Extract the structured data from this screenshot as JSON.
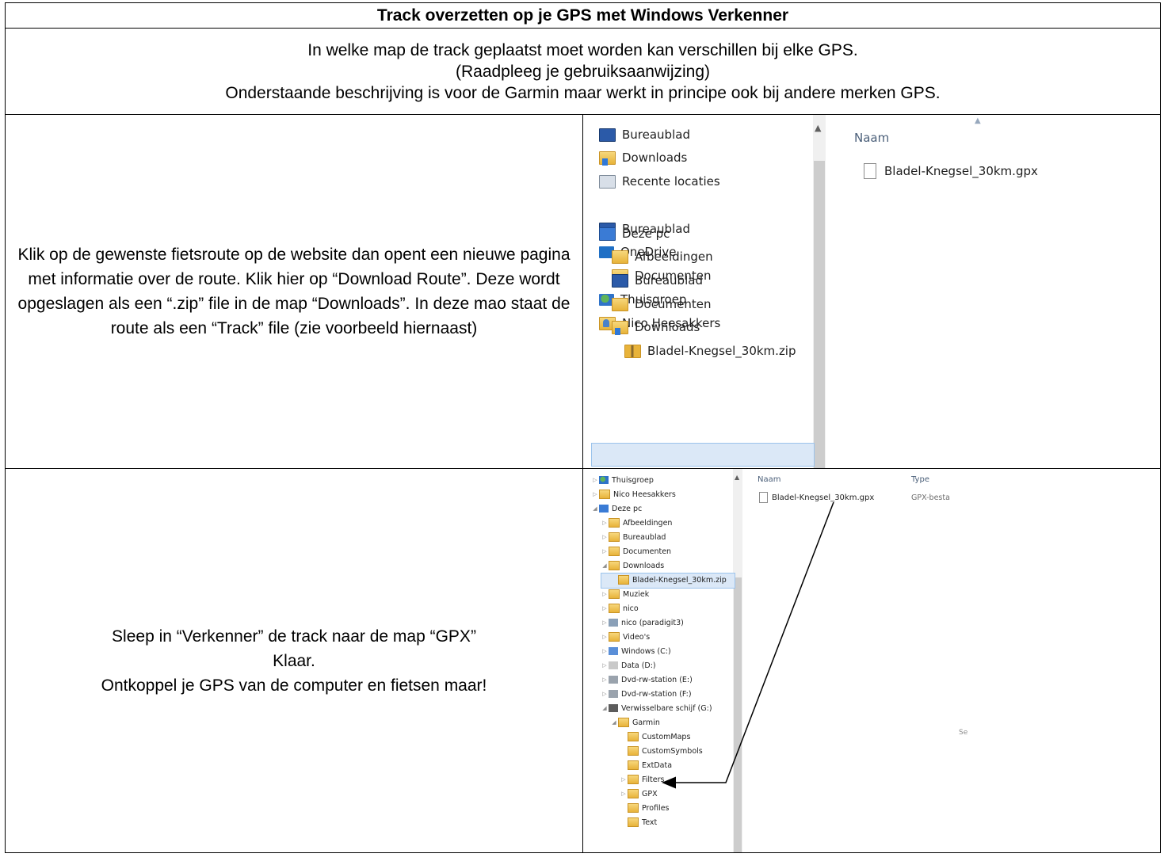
{
  "title": "Track overzetten op je GPS met Windows Verkenner",
  "intro": [
    "In welke map de track geplaatst moet worden kan verschillen bij elke GPS.",
    "(Raadpleeg je gebruiksaanwijzing)",
    "Onderstaande beschrijving is voor de Garmin maar werkt in principe ook bij andere merken GPS."
  ],
  "step1": {
    "text": "Klik op de gewenste fietsroute op de website dan opent een nieuwe pagina met informatie over de route. Klik hier op “Download Route”. Deze wordt opgeslagen als een “.zip” file in de map “Downloads”. In deze mao staat de route als een “Track” file (zie voorbeeld hiernaast)",
    "explorer": {
      "column_name": "Naam",
      "file": "Bladel-Knegsel_30km.gpx",
      "items": [
        {
          "label": "Bureaublad",
          "icon": "desktop-icon"
        },
        {
          "label": "Downloads",
          "icon": "downloads-folder-icon"
        },
        {
          "label": "Recente locaties",
          "icon": "recent-locations-icon"
        },
        {
          "label": "Bureaublad",
          "icon": "desktop-icon"
        },
        {
          "label": "OneDrive",
          "icon": "onedrive-icon"
        },
        {
          "label": "Documenten",
          "icon": "folder-icon"
        },
        {
          "label": "Thuisgroep",
          "icon": "homegroup-icon"
        },
        {
          "label": "Nico Heesakkers",
          "icon": "user-folder-icon"
        },
        {
          "label": "Deze pc",
          "icon": "computer-icon"
        },
        {
          "label": "Afbeeldingen",
          "icon": "pictures-folder-icon"
        },
        {
          "label": "Bureaublad",
          "icon": "desktop-folder-icon"
        },
        {
          "label": "Documenten",
          "icon": "documents-folder-icon"
        },
        {
          "label": "Downloads",
          "icon": "downloads-folder-icon"
        },
        {
          "label": "Bladel-Knegsel_30km.zip",
          "icon": "zip-folder-icon"
        }
      ]
    }
  },
  "step2": {
    "line1": "Sleep in “Verkenner” de track naar de map “GPX”",
    "line2": "Klaar.",
    "line3": "Ontkoppel je GPS van de computer en fietsen maar!",
    "explorer": {
      "col_name": "Naam",
      "col_type": "Type",
      "file": "Bladel-Knegsel_30km.gpx",
      "file_type": "GPX-besta",
      "side_text": "Se",
      "items": [
        {
          "label": "Thuisgroep",
          "icon": "homegroup-icon"
        },
        {
          "label": "Nico Heesakkers",
          "icon": "user-folder-icon"
        },
        {
          "label": "Deze pc",
          "icon": "computer-icon"
        },
        {
          "label": "Afbeeldingen",
          "icon": "pictures-folder-icon"
        },
        {
          "label": "Bureaublad",
          "icon": "desktop-folder-icon"
        },
        {
          "label": "Documenten",
          "icon": "documents-folder-icon"
        },
        {
          "label": "Downloads",
          "icon": "downloads-folder-icon"
        },
        {
          "label": "Bladel-Knegsel_30km.zip",
          "icon": "zip-folder-icon"
        },
        {
          "label": "Muziek",
          "icon": "music-folder-icon"
        },
        {
          "label": "nico",
          "icon": "user-folder-icon"
        },
        {
          "label": "nico (paradigit3)",
          "icon": "network-drive-icon"
        },
        {
          "label": "Video's",
          "icon": "videos-folder-icon"
        },
        {
          "label": "Windows (C:)",
          "icon": "windows-drive-icon"
        },
        {
          "label": "Data (D:)",
          "icon": "drive-icon"
        },
        {
          "label": "Dvd-rw-station (E:)",
          "icon": "dvd-drive-icon"
        },
        {
          "label": "Dvd-rw-station (F:)",
          "icon": "dvd-drive-icon"
        },
        {
          "label": "Verwisselbare schijf (G:)",
          "icon": "removable-drive-icon"
        },
        {
          "label": "Garmin",
          "icon": "folder-icon"
        },
        {
          "label": "CustomMaps",
          "icon": "folder-icon"
        },
        {
          "label": "CustomSymbols",
          "icon": "folder-icon"
        },
        {
          "label": "ExtData",
          "icon": "folder-icon"
        },
        {
          "label": "Filters",
          "icon": "folder-icon"
        },
        {
          "label": "GPX",
          "icon": "folder-icon"
        },
        {
          "label": "Profiles",
          "icon": "folder-icon"
        },
        {
          "label": "Text",
          "icon": "folder-icon"
        }
      ]
    }
  }
}
